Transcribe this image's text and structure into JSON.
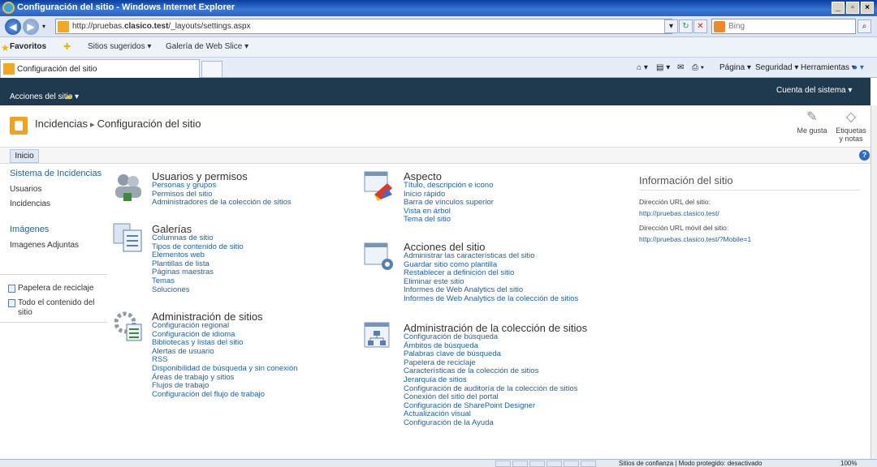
{
  "browser": {
    "title": "Configuración del sitio - Windows Internet Explorer",
    "url_prefix": "http://pruebas.",
    "url_domain": "clasico.test",
    "url_path": "/_layouts/settings.aspx",
    "search_placeholder": "Bing",
    "favorites_label": "Favoritos",
    "fav_links": [
      "Sitios sugeridos ▾",
      "Galería de Web Slice ▾"
    ],
    "tab_title": "Configuración del sitio",
    "commands": [
      "Página ▾",
      "Seguridad ▾",
      "Herramientas ▾"
    ],
    "status_text": "Sitios de confianza | Modo protegido: desactivado",
    "zoom": "100%"
  },
  "ribbon": {
    "site_actions": "Acciones del sitio ▾",
    "account": "Cuenta del sistema ▾"
  },
  "title_area": {
    "site": "Incidencias",
    "separator": "▸",
    "page": "Configuración del sitio",
    "like": "Me gusta",
    "tags_line1": "Etiquetas",
    "tags_line2": "y notas"
  },
  "nav": {
    "home_tab": "Inicio"
  },
  "quick_launch": {
    "heading1": "Sistema de Incidencias",
    "items1": [
      "Usuarios",
      "Incidencias"
    ],
    "heading2": "Imágenes",
    "items2": [
      "Imagenes Adjuntas"
    ],
    "recycle": "Papelera de reciclaje",
    "all_content": "Todo el contenido del sitio"
  },
  "sections": {
    "users": {
      "title": "Usuarios y permisos",
      "links": [
        "Personas y grupos",
        "Permisos del sitio",
        "Administradores de la colección de sitios"
      ]
    },
    "galleries": {
      "title": "Galerías",
      "links": [
        "Columnas de sitio",
        "Tipos de contenido de sitio",
        "Elementos web",
        "Plantillas de lista",
        "Páginas maestras",
        "Temas",
        "Soluciones"
      ]
    },
    "site_admin": {
      "title": "Administración de sitios",
      "links": [
        "Configuración regional",
        "Configuración de idioma",
        "Bibliotecas y listas del sitio",
        "Alertas de usuario",
        "RSS",
        "Disponibilidad de búsqueda y sin conexión",
        "Áreas de trabajo y sitios",
        "Flujos de trabajo",
        "Configuración del flujo de trabajo"
      ]
    },
    "look": {
      "title": "Aspecto",
      "links": [
        "Título, descripción e icono",
        "Inicio rápido",
        "Barra de vínculos superior",
        "Vista en árbol",
        "Tema del sitio"
      ]
    },
    "site_actions": {
      "title": "Acciones del sitio",
      "links": [
        "Administrar las características del sitio",
        "Guardar sitio como plantilla",
        "Restablecer a definición del sitio",
        "Eliminar este sitio",
        "Informes de Web Analytics del sitio",
        "Informes de Web Analytics de la colección de sitios"
      ]
    },
    "collection_admin": {
      "title": "Administración de la colección de sitios",
      "links": [
        "Configuración de búsqueda",
        "Ámbitos de búsqueda",
        "Palabras clave de búsqueda",
        "Papelera de reciclaje",
        "Características de la colección de sitios",
        "Jerarquía de sitios",
        "Configuración de auditoría de la colección de sitios",
        "Conexión del sitio del portal",
        "Configuración de SharePoint Designer",
        "Actualización visual",
        "Configuración de la Ayuda"
      ]
    }
  },
  "site_info": {
    "heading": "Información del sitio",
    "url_label": "Dirección URL del sitio:",
    "url_value": "http://pruebas.clasico.test/",
    "mobile_label": "Dirección URL móvil del sitio:",
    "mobile_value": "http://pruebas.clasico.test/?Mobile=1"
  },
  "colors": {
    "ribbon": "#1f3a4f",
    "link": "#1f61a8",
    "accent": "#f1a320"
  }
}
